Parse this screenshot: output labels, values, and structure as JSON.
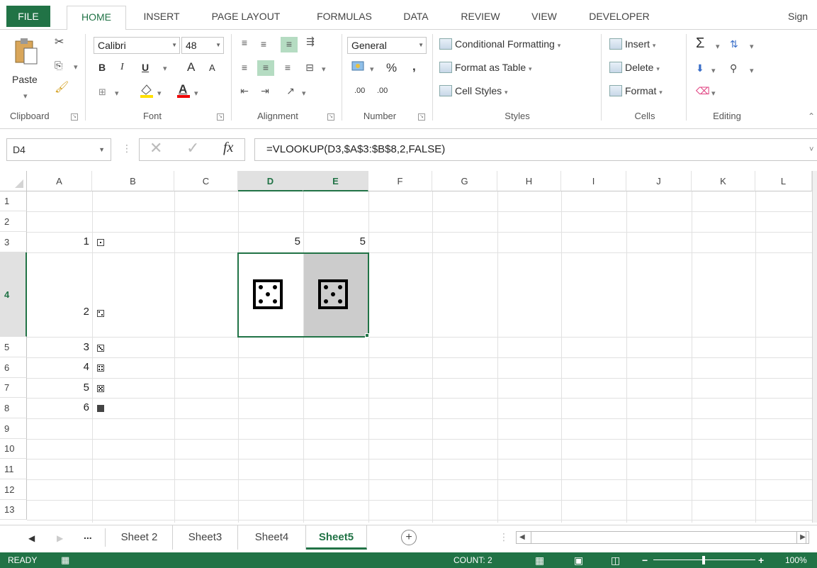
{
  "ribbon_tabs": {
    "file": "FILE",
    "home": "HOME",
    "insert": "INSERT",
    "page_layout": "PAGE LAYOUT",
    "formulas": "FORMULAS",
    "data": "DATA",
    "review": "REVIEW",
    "view": "VIEW",
    "developer": "DEVELOPER",
    "sign_in": "Sign"
  },
  "clipboard": {
    "paste": "Paste",
    "label": "Clipboard"
  },
  "font": {
    "name": "Calibri",
    "size": "48",
    "bold": "B",
    "italic": "I",
    "underline": "U",
    "grow": "A",
    "shrink": "A",
    "color_letter": "A",
    "label": "Font"
  },
  "alignment": {
    "label": "Alignment"
  },
  "number": {
    "format": "General",
    "percent": "%",
    "comma": ",",
    "inc_decimal": ".00",
    "dec_decimal": ".00",
    "label": "Number"
  },
  "styles": {
    "conditional": "Conditional Formatting",
    "table": "Format as Table",
    "cell_styles": "Cell Styles",
    "label": "Styles"
  },
  "cells": {
    "insert": "Insert",
    "delete": "Delete",
    "format": "Format",
    "label": "Cells"
  },
  "editing": {
    "sum": "Σ",
    "label": "Editing"
  },
  "formula_bar": {
    "name_box": "D4",
    "fx": "fx",
    "formula": "=VLOOKUP(D3,$A$3:$B$8,2,FALSE)"
  },
  "columns": [
    "A",
    "B",
    "C",
    "D",
    "E",
    "F",
    "G",
    "H",
    "I",
    "J",
    "K",
    "L"
  ],
  "rows": [
    "1",
    "2",
    "3",
    "4",
    "5",
    "6",
    "7",
    "8",
    "9",
    "10",
    "11",
    "12",
    "13"
  ],
  "cells_data": {
    "A3": "1",
    "A4": "2",
    "A5": "3",
    "A6": "4",
    "A7": "5",
    "A8": "6",
    "D3": "5",
    "E3": "5"
  },
  "sheet_tabs": {
    "ellipsis": "...",
    "tabs": [
      "Sheet 2",
      "Sheet3",
      "Sheet4",
      "Sheet5"
    ],
    "active": "Sheet5"
  },
  "status": {
    "mode": "READY",
    "count": "COUNT: 2",
    "zoom": "100%"
  },
  "colors": {
    "accent": "#217346",
    "selected_fill": "#cccccc"
  }
}
